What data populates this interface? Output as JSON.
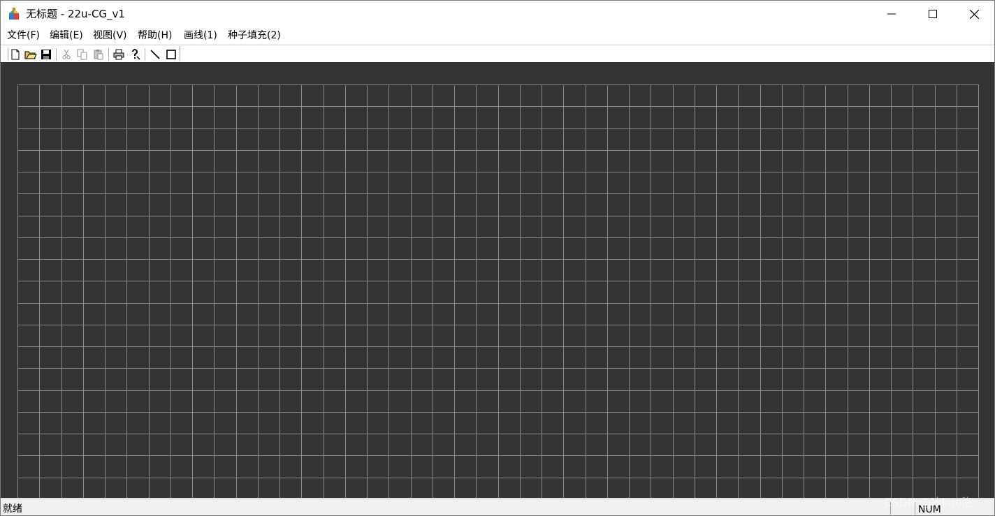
{
  "window": {
    "title": "无标题 - 22u-CG_v1"
  },
  "menu": {
    "items": [
      "文件(F)",
      "编辑(E)",
      "视图(V)",
      "帮助(H)",
      "画线(1)",
      "种子填充(2)"
    ]
  },
  "toolbar": {
    "buttons": [
      "new-file-icon",
      "open-folder-icon",
      "save-icon",
      "cut-icon",
      "copy-icon",
      "paste-icon",
      "print-icon",
      "help-icon",
      "line-tool-icon",
      "rectangle-tool-icon"
    ]
  },
  "canvas": {
    "background": "#333333",
    "grid_color": "#8a8a8a"
  },
  "status": {
    "text": "就绪",
    "num": "NUM"
  },
  "watermark": {
    "text": "CSDN @冰kuo洛"
  }
}
